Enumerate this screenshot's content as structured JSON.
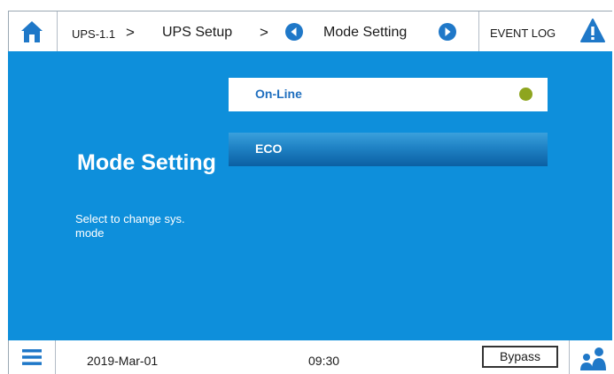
{
  "topbar": {
    "device": "UPS-1.1",
    "section": "UPS Setup",
    "page": "Mode Setting",
    "event_log": "EVENT LOG",
    "chevron": ">",
    "home_icon": "home-icon",
    "prev_icon": "circle-arrow-left-icon",
    "next_icon": "circle-arrow-right-icon",
    "alert_icon": "warning-triangle-icon"
  },
  "panel": {
    "title": "Mode Setting",
    "subtitle": "Select to change sys. mode"
  },
  "modes": [
    {
      "label": "On-Line",
      "selected": true,
      "status_color": "#8ea51f"
    },
    {
      "label": "ECO",
      "selected": false
    }
  ],
  "statusbar": {
    "date": "2019-Mar-01",
    "time": "09:30",
    "mode_badge": "Bypass",
    "menu_icon": "hamburger-menu-icon",
    "user_icon": "users-icon"
  },
  "colors": {
    "accent": "#0e8fdb",
    "label_blue": "#1f6fbf",
    "alert": "#1f78c8"
  }
}
